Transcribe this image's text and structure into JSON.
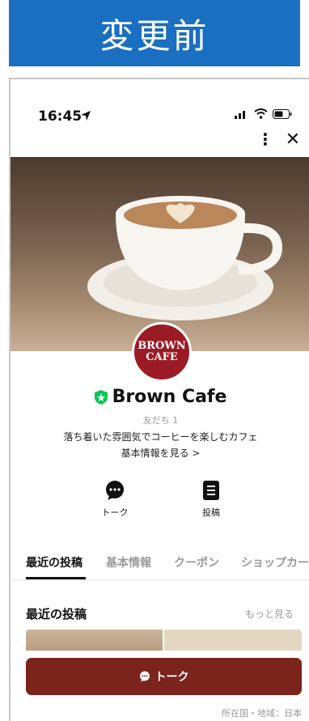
{
  "banner": {
    "title": "変更前"
  },
  "status_bar": {
    "time": "16:45"
  },
  "profile": {
    "logo_text_line1": "BROWN",
    "logo_text_line2": "CAFE",
    "name": "Brown Cafe",
    "friends": "友だち 1",
    "description": "落ち着いた雰囲気でコーヒーを楽しむカフェ",
    "info_link": "基本情報を見る >"
  },
  "actions": [
    {
      "label": "トーク",
      "icon": "chat-bubble-icon"
    },
    {
      "label": "投稿",
      "icon": "post-list-icon"
    }
  ],
  "tabs": [
    {
      "label": "最近の投稿",
      "active": true
    },
    {
      "label": "基本情報",
      "active": false
    },
    {
      "label": "クーポン",
      "active": false
    },
    {
      "label": "ショップカー",
      "active": false
    }
  ],
  "posts": {
    "title": "最近の投稿",
    "more": "もっと見る"
  },
  "talk_button": {
    "label": "トーク"
  },
  "footer": {
    "region": "所在国・地域：日本"
  },
  "colors": {
    "banner": "#1a6fc1",
    "logo_bg": "#9a1b26",
    "talk_button": "#7a241c",
    "verified_badge": "#06c755"
  }
}
